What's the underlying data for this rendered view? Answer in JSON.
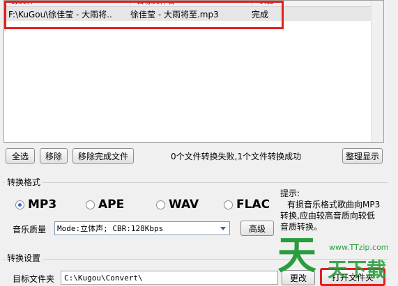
{
  "file_list": {
    "columns": [
      "源文件",
      "目标文件名",
      "状态"
    ],
    "rows": [
      {
        "source": "F:\\KuGou\\徐佳莹 - 大雨将..",
        "target": "徐佳莹 - 大雨将至.mp3",
        "status": "完成"
      }
    ]
  },
  "list_buttons": {
    "select_all": "全选",
    "remove": "移除",
    "remove_done": "移除完成文件",
    "tidy": "整理显示"
  },
  "status_text": "0个文件转换失败,1个文件转换成功",
  "format": {
    "title": "转换格式",
    "options": [
      "MP3",
      "APE",
      "WAV",
      "FLAC"
    ],
    "selected": "MP3",
    "quality_label": "音乐质量",
    "quality_value": "Mode:立体声; CBR:128Kbps",
    "advanced": "高级",
    "tip_title": "提示:",
    "tip_lines": [
      "有损音乐格式歌曲向MP3",
      "转换,应由较高音质向较低",
      "音质转换。"
    ]
  },
  "settings": {
    "title": "转换设置",
    "target_folder_label": "目标文件夹",
    "target_folder_value": "C:\\Kugou\\Convert\\",
    "change": "更改",
    "open_folder": "打开文件夹"
  },
  "watermark": {
    "text": "www.TTzip.com",
    "logo_chars": "天天下载"
  },
  "colors": {
    "highlight": "#e02020",
    "radio_selected": "#2a6fd8",
    "watermark": "#2a9d3c"
  }
}
